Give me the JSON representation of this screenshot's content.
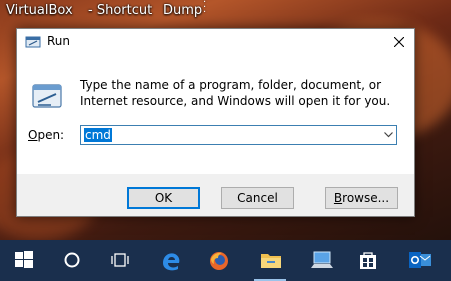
{
  "desktop": {
    "labels": [
      "VirtualBox",
      "- Shortcut",
      "Dump"
    ]
  },
  "dialog": {
    "title": "Run",
    "message": "Type the name of a program, folder, document, or Internet resource, and Windows will open it for you.",
    "open_label_prefix": "O",
    "open_label_rest": "pen:",
    "input_value": "cmd",
    "ok_label": "OK",
    "cancel_label": "Cancel",
    "browse_prefix": "B",
    "browse_rest": "rowse..."
  },
  "taskbar": {
    "items": [
      "start-icon",
      "cortana-icon",
      "task-view-icon",
      "edge-icon",
      "firefox-icon",
      "file-explorer-icon",
      "remote-desktop-icon",
      "store-icon",
      "outlook-icon"
    ],
    "accent": "#1a2f4d"
  },
  "colors": {
    "selection": "#0078d7",
    "button_face": "#e1e1e1",
    "footer": "#f0f0f0"
  }
}
